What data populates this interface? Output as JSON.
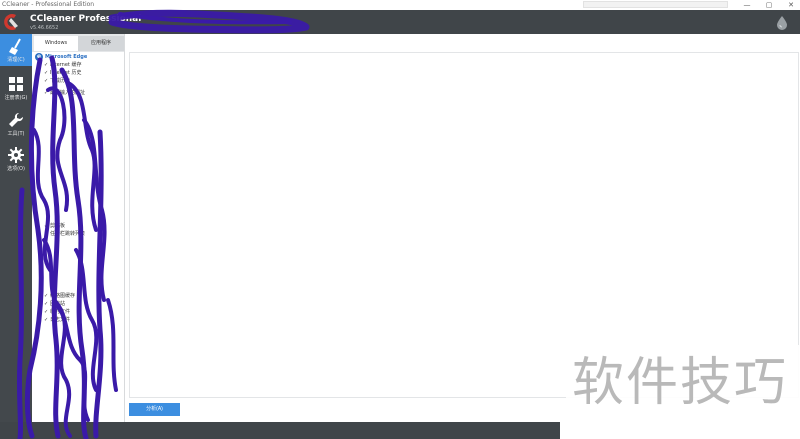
{
  "window": {
    "title": "CCleaner - Professional Edition"
  },
  "header": {
    "app_name": "CCleaner Professional",
    "version": "v5.46.6652"
  },
  "sidebar": {
    "items": [
      {
        "label": "清理(C)",
        "icon": "broom-icon",
        "active": true
      },
      {
        "label": "注册表(G)",
        "icon": "registry-grid-icon",
        "active": false
      },
      {
        "label": "工具(T)",
        "icon": "wrench-icon",
        "active": false
      },
      {
        "label": "选项(O)",
        "icon": "gear-icon",
        "active": false
      }
    ]
  },
  "tabs": [
    {
      "label": "Windows",
      "active": true
    },
    {
      "label": "应用程序",
      "active": false
    }
  ],
  "tree": {
    "section_title": "Microsoft Edge",
    "items": [
      {
        "label": "Internet 缓存"
      },
      {
        "label": "Internet 历史"
      },
      {
        "label": "下载历史"
      },
      {
        "label": "最近输入的网址"
      },
      {
        "label": "剪贴板"
      },
      {
        "label": "任务栏跳转列表"
      },
      {
        "label": "缩略图缓存"
      },
      {
        "label": "回收站"
      },
      {
        "label": "临时文件"
      },
      {
        "label": "日志文件"
      }
    ]
  },
  "actions": {
    "analyze_label": "分析(A)"
  },
  "watermark": {
    "text": "软件技巧"
  },
  "colors": {
    "header_bg": "#404549",
    "sidebar_bg": "#43484c",
    "accent": "#3c8ee0",
    "scribble": "#3a1aa8"
  }
}
